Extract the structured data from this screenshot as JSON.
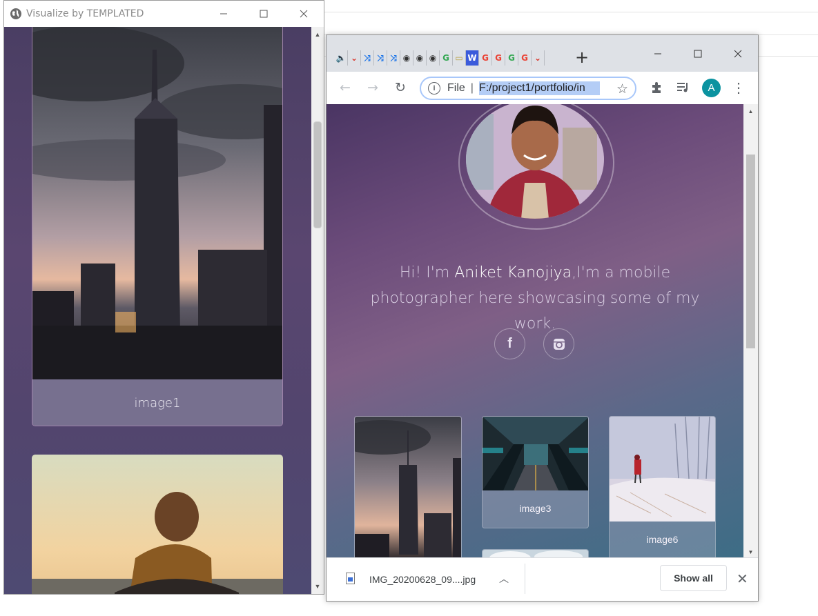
{
  "left_window": {
    "title": "Visualize by TEMPLATED",
    "card1_caption": "image1"
  },
  "browser": {
    "omnibox": {
      "scheme_label": "File",
      "separator": "|",
      "url": "F:/project1/portfolio/in"
    },
    "avatar_letter": "A",
    "page": {
      "intro_prefix": "Hi! I'm ",
      "intro_name": "Aniket Kanojiya",
      "intro_suffix": ",I'm a mobile photographer here showcasing some of my work.",
      "gallery": [
        {
          "caption": "image3"
        },
        {
          "caption": "image6"
        }
      ]
    },
    "download": {
      "filename": "IMG_20200628_09....jpg",
      "show_all_label": "Show all"
    }
  },
  "colors": {
    "accent_avatar": "#0b93a0",
    "url_highlight": "#b4cdf6"
  }
}
